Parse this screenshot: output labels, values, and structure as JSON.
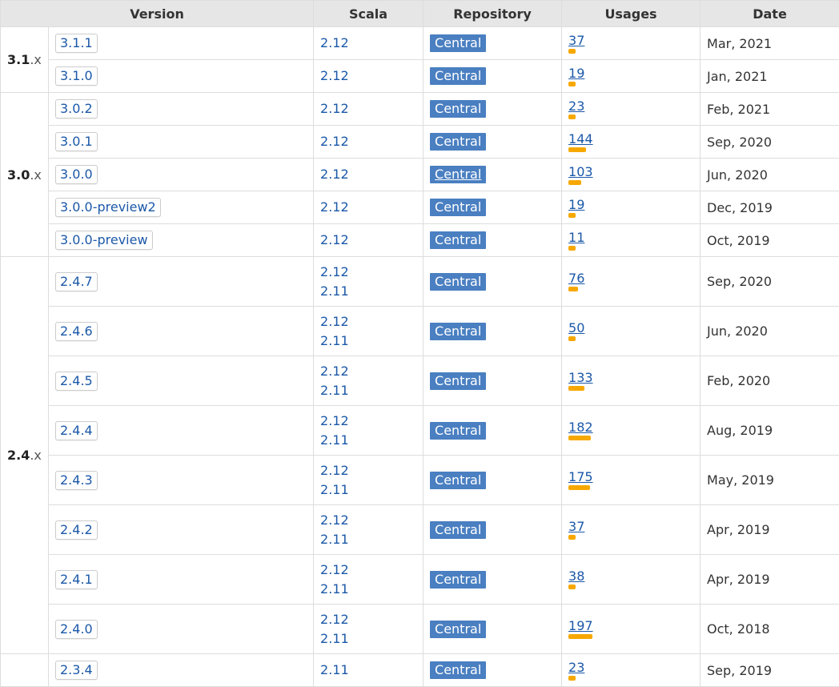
{
  "headers": {
    "version": "Version",
    "scala": "Scala",
    "repository": "Repository",
    "usages": "Usages",
    "date": "Date"
  },
  "groups": [
    {
      "label": "3.1",
      "suffix": ".x"
    },
    {
      "label": "3.0",
      "suffix": ".x"
    },
    {
      "label": "2.4",
      "suffix": ".x"
    }
  ],
  "rows": [
    {
      "version": "3.1.1",
      "scala": [
        "2.12"
      ],
      "repo": "Central",
      "usages": "37",
      "date": "Mar, 2021"
    },
    {
      "version": "3.1.0",
      "scala": [
        "2.12"
      ],
      "repo": "Central",
      "usages": "19",
      "date": "Jan, 2021"
    },
    {
      "version": "3.0.2",
      "scala": [
        "2.12"
      ],
      "repo": "Central",
      "usages": "23",
      "date": "Feb, 2021"
    },
    {
      "version": "3.0.1",
      "scala": [
        "2.12"
      ],
      "repo": "Central",
      "usages": "144",
      "date": "Sep, 2020"
    },
    {
      "version": "3.0.0",
      "scala": [
        "2.12"
      ],
      "repo": "Central",
      "usages": "103",
      "date": "Jun, 2020"
    },
    {
      "version": "3.0.0-preview2",
      "scala": [
        "2.12"
      ],
      "repo": "Central",
      "usages": "19",
      "date": "Dec, 2019"
    },
    {
      "version": "3.0.0-preview",
      "scala": [
        "2.12"
      ],
      "repo": "Central",
      "usages": "11",
      "date": "Oct, 2019"
    },
    {
      "version": "2.4.7",
      "scala": [
        "2.12",
        "2.11"
      ],
      "repo": "Central",
      "usages": "76",
      "date": "Sep, 2020"
    },
    {
      "version": "2.4.6",
      "scala": [
        "2.12",
        "2.11"
      ],
      "repo": "Central",
      "usages": "50",
      "date": "Jun, 2020"
    },
    {
      "version": "2.4.5",
      "scala": [
        "2.12",
        "2.11"
      ],
      "repo": "Central",
      "usages": "133",
      "date": "Feb, 2020"
    },
    {
      "version": "2.4.4",
      "scala": [
        "2.12",
        "2.11"
      ],
      "repo": "Central",
      "usages": "182",
      "date": "Aug, 2019"
    },
    {
      "version": "2.4.3",
      "scala": [
        "2.12",
        "2.11"
      ],
      "repo": "Central",
      "usages": "175",
      "date": "May, 2019"
    },
    {
      "version": "2.4.2",
      "scala": [
        "2.12",
        "2.11"
      ],
      "repo": "Central",
      "usages": "37",
      "date": "Apr, 2019"
    },
    {
      "version": "2.4.1",
      "scala": [
        "2.12",
        "2.11"
      ],
      "repo": "Central",
      "usages": "38",
      "date": "Apr, 2019"
    },
    {
      "version": "2.4.0",
      "scala": [
        "2.12",
        "2.11"
      ],
      "repo": "Central",
      "usages": "197",
      "date": "Oct, 2018"
    },
    {
      "version": "2.3.4",
      "scala": [
        "2.11"
      ],
      "repo": "Central",
      "usages": "23",
      "date": "Sep, 2019"
    }
  ],
  "colors": {
    "link": "#1b58a8",
    "repo_badge": "#4a7fc1",
    "usage_bar": "#f7a800",
    "header_bg": "#e6e6e6"
  }
}
